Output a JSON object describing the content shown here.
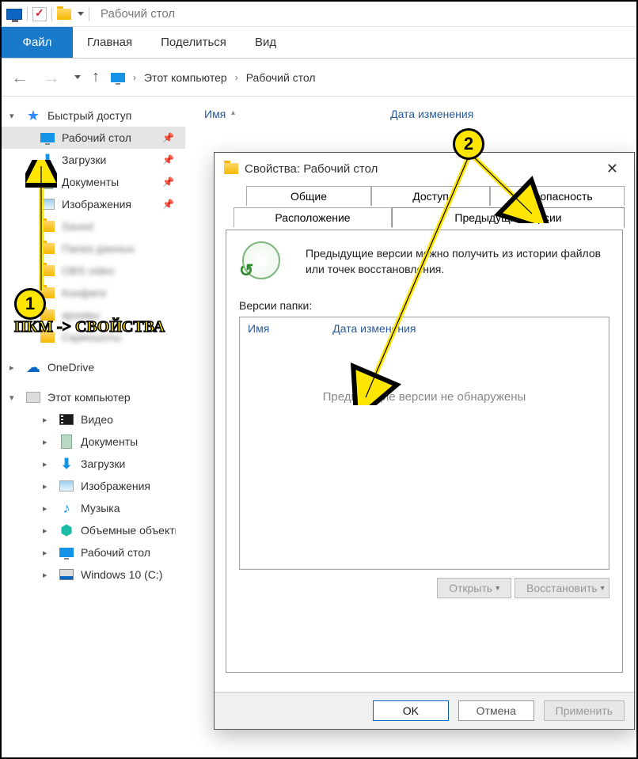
{
  "titlebar": {
    "title": "Рабочий стол"
  },
  "ribbon": {
    "file": "Файл",
    "tabs": [
      "Главная",
      "Поделиться",
      "Вид"
    ]
  },
  "breadcrumb": {
    "root": "Этот компьютер",
    "current": "Рабочий стол"
  },
  "list_headers": {
    "name": "Имя",
    "date": "Дата изменения"
  },
  "sidebar": {
    "quick_access": "Быстрый доступ",
    "items": [
      {
        "label": "Рабочий стол",
        "icon": "monitor",
        "pinned": true,
        "selected": true
      },
      {
        "label": "Загрузки",
        "icon": "download",
        "pinned": true
      },
      {
        "label": "Документы",
        "icon": "doc",
        "pinned": true
      },
      {
        "label": "Изображения",
        "icon": "img",
        "pinned": true
      }
    ],
    "blurred_count": 6,
    "onedrive": "OneDrive",
    "this_pc": "Этот компьютер",
    "pc_items": [
      {
        "label": "Видео",
        "icon": "video"
      },
      {
        "label": "Документы",
        "icon": "doc"
      },
      {
        "label": "Загрузки",
        "icon": "download"
      },
      {
        "label": "Изображения",
        "icon": "img"
      },
      {
        "label": "Музыка",
        "icon": "music"
      },
      {
        "label": "Объемные объекты",
        "icon": "3d"
      },
      {
        "label": "Рабочий стол",
        "icon": "monitor"
      },
      {
        "label": "Windows 10 (C:)",
        "icon": "disk"
      }
    ]
  },
  "dialog": {
    "title": "Свойства: Рабочий стол",
    "tabs_row1": [
      "Общие",
      "Доступ",
      "Безопасность"
    ],
    "tabs_row2": [
      "Расположение",
      "Предыдущие версии"
    ],
    "active_tab": "Предыдущие версии",
    "info_text": "Предыдущие версии можно получить из истории файлов или точек восстановления.",
    "versions_label": "Версии папки:",
    "inner_headers": {
      "name": "Имя",
      "date": "Дата изменения"
    },
    "empty_text": "Предыдущие версии не обнаружены",
    "open_btn": "Открыть",
    "restore_btn": "Восстановить",
    "ok": "OK",
    "cancel": "Отмена",
    "apply": "Применить"
  },
  "annotations": {
    "badge1": "1",
    "badge2": "2",
    "text1": "ПКМ -> СВОЙСТВА"
  }
}
